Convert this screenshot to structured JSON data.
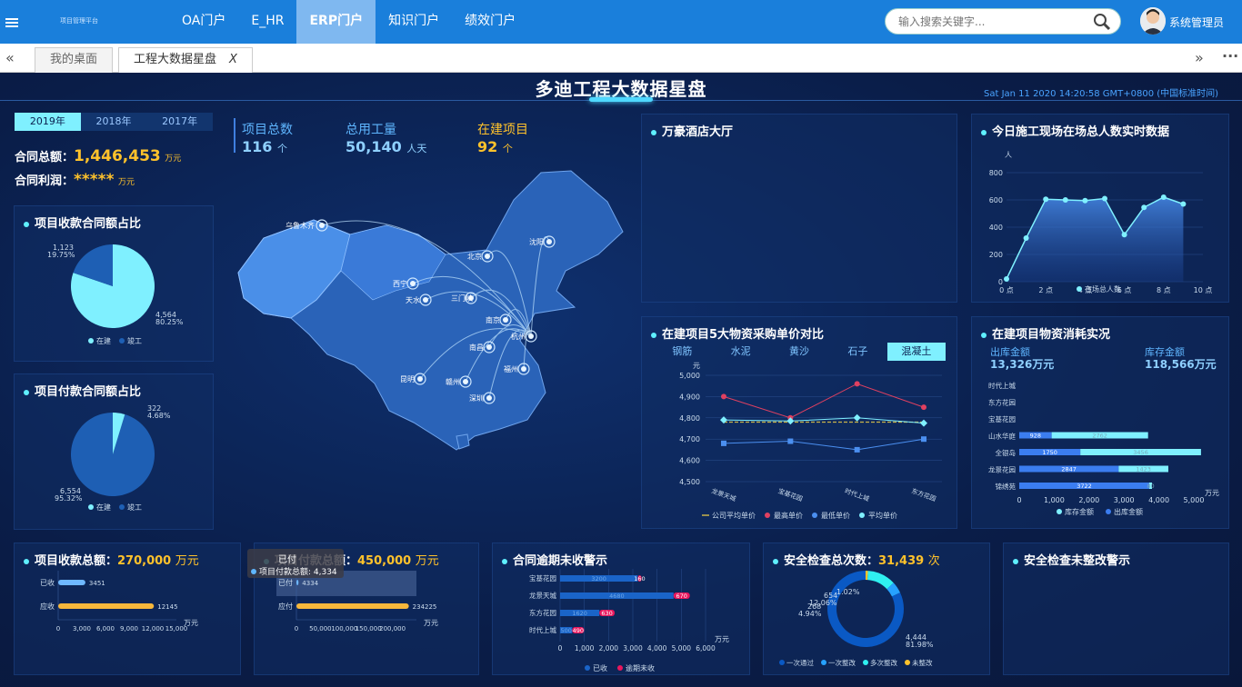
{
  "nav": {
    "brand": "项目管理平台",
    "items": [
      {
        "label": "OA门户",
        "active": false
      },
      {
        "label": "E_HR",
        "active": false
      },
      {
        "label": "ERP门户",
        "active": true
      },
      {
        "label": "知识门户",
        "active": false
      },
      {
        "label": "绩效门户",
        "active": false
      }
    ],
    "search_placeholder": "输入搜索关键字...",
    "user": "系统管理员"
  },
  "tabs": {
    "home": "我的桌面",
    "current": "工程大数据星盘",
    "close": "X"
  },
  "dashboard": {
    "title": "多迪工程大数据星盘",
    "datetime": "Sat Jan 11 2020 14:20:58 GMT+0800 (中国标准时间)",
    "years": [
      "2019年",
      "2018年",
      "2017年"
    ],
    "contract_total_label": "合同总额：",
    "contract_total": "1,446,453",
    "contract_profit_label": "合同利润：",
    "contract_profit": "*****",
    "unit_wan": "万元",
    "stats": [
      {
        "label": "项目总数",
        "value": "116",
        "unit": "个",
        "color": "#5fb6ff"
      },
      {
        "label": "总用工量",
        "value": "50,140",
        "unit": "人天",
        "color": "#5fb6ff"
      },
      {
        "label": "在建项目",
        "value": "92",
        "unit": "个",
        "color": "#ffc22b"
      }
    ],
    "map_cities": [
      "乌鲁木齐",
      "北京",
      "沈阳",
      "西宁",
      "天水",
      "三门峡",
      "南京",
      "杭州",
      "南昌",
      "昆明",
      "赣州",
      "福州",
      "深圳"
    ]
  },
  "panels": {
    "receipt_ratio": {
      "title": "项目收款合同额占比",
      "legend": [
        "在建",
        "竣工"
      ],
      "in_progress": {
        "value": "4,564",
        "pct": "80.25%"
      },
      "done": {
        "value": "1,123",
        "pct": "19.75%"
      }
    },
    "payment_ratio": {
      "title": "项目付款合同额占比",
      "legend": [
        "在建",
        "竣工"
      ],
      "in_progress": {
        "value": "6,554",
        "pct": "95.32%"
      },
      "done": {
        "value": "322",
        "pct": "4.68%"
      }
    },
    "hotel": {
      "title": "万豪酒店大厅"
    },
    "realtime": {
      "title": "今日施工现场在场总人数实时数据",
      "ylabel": "人",
      "legend": "在场总人数"
    },
    "material_price": {
      "title": "在建项目5大物资采购单价对比",
      "tabs": [
        "钢筋",
        "水泥",
        "黄沙",
        "石子",
        "混凝土"
      ],
      "ylabel": "元",
      "legend": [
        "公司平均单价",
        "最高单价",
        "最低单价",
        "平均单价"
      ]
    },
    "material_use": {
      "title": "在建项目物资消耗实况",
      "out_label": "出库金额",
      "out_value": "13,326万元",
      "stock_label": "库存金额",
      "stock_value": "118,566万元",
      "legend": [
        "库存金额",
        "出库金额"
      ],
      "xunit": "万元"
    },
    "receipt_total": {
      "title": "项目收款总额：",
      "value": "270,000",
      "unit": "万元",
      "xunit": "万元"
    },
    "payment_total": {
      "title": "项目付款总额：",
      "value": "450,000",
      "unit": "万元",
      "tooltip_head": "已付",
      "tooltip_body": "项目付款总额: 4,334",
      "xunit": "万元"
    },
    "overdue": {
      "title": "合同逾期未收警示",
      "legend": [
        "已收",
        "逾期未收"
      ],
      "xunit": "万元"
    },
    "safety": {
      "title": "安全检查总次数：",
      "value": "31,439",
      "unit": "次",
      "legend": [
        "一次通过",
        "一次整改",
        "多次整改",
        "未整改"
      ]
    },
    "safety_warn": {
      "title": "安全检查未整改警示"
    }
  },
  "chart_data": [
    {
      "type": "pie",
      "title": "项目收款合同额占比",
      "series": [
        {
          "name": "在建",
          "value": 4564,
          "pct": "80.25%"
        },
        {
          "name": "竣工",
          "value": 1123,
          "pct": "19.75%"
        }
      ]
    },
    {
      "type": "pie",
      "title": "项目付款合同额占比",
      "series": [
        {
          "name": "在建",
          "value": 6554,
          "pct": "95.32%"
        },
        {
          "name": "竣工",
          "value": 322,
          "pct": "4.68%"
        }
      ]
    },
    {
      "type": "area",
      "title": "今日施工现场在场总人数实时数据",
      "ylabel": "人",
      "x": [
        0,
        1,
        2,
        3,
        4,
        5,
        6,
        7,
        8,
        9,
        10
      ],
      "x_ticks": [
        "0 点",
        "2 点",
        "4 点",
        "6 点",
        "8 点",
        "10 点"
      ],
      "x_tick_values": [
        0,
        2,
        4,
        6,
        8,
        10
      ],
      "series": [
        {
          "name": "在场总人数",
          "values": [
            20,
            320,
            605,
            600,
            595,
            610,
            345,
            545,
            620,
            570,
            null
          ]
        }
      ],
      "ylim": [
        0,
        800
      ],
      "y_ticks": [
        0,
        200,
        400,
        600,
        800
      ],
      "xlim": [
        0,
        10
      ]
    },
    {
      "type": "line",
      "title": "在建项目5大物资采购单价对比",
      "ylabel": "元",
      "categories": [
        "龙景天城",
        "宝基花园",
        "时代上城",
        "东方花园"
      ],
      "ylim": [
        4500,
        5000
      ],
      "y_ticks": [
        "4,500",
        "4,600",
        "4,700",
        "4,800",
        "4,900",
        "5,000"
      ],
      "series": [
        {
          "name": "公司平均单价",
          "values": [
            4780,
            4780,
            4780,
            4780
          ],
          "color": "#c9b34a"
        },
        {
          "name": "最高单价",
          "values": [
            4900,
            4800,
            4960,
            4850
          ],
          "color": "#e04060"
        },
        {
          "name": "最低单价",
          "values": [
            4680,
            4690,
            4650,
            4700
          ],
          "color": "#4b8ff0"
        },
        {
          "name": "平均单价",
          "values": [
            4790,
            4785,
            4800,
            4775
          ],
          "color": "#7ff0ff"
        }
      ]
    },
    {
      "type": "bar",
      "title": "在建项目物资消耗实况",
      "orientation": "horizontal",
      "stacked": true,
      "categories": [
        "时代上城",
        "东方花园",
        "宝基花园",
        "山水华庭",
        "全银岛",
        "龙景花园",
        "锦绣苑"
      ],
      "xlim": [
        0,
        5000
      ],
      "x_ticks": [
        "0",
        "1,000",
        "2,000",
        "3,000",
        "4,000",
        "5,000"
      ],
      "series": [
        {
          "name": "出库金额",
          "values": [
            0,
            0,
            0,
            928,
            1750,
            2847,
            3722
          ],
          "color": "#3b7df0"
        },
        {
          "name": "库存金额",
          "values": [
            0,
            0,
            0,
            2762,
            3456,
            1423,
            80
          ],
          "color": "#7ff0ff"
        }
      ]
    },
    {
      "type": "bar",
      "title": "项目收款总额",
      "orientation": "horizontal",
      "categories": [
        "已收",
        "应收"
      ],
      "values": [
        3451,
        12145
      ],
      "xlim": [
        0,
        15000
      ],
      "x_ticks": [
        "0",
        "3,000",
        "6,000",
        "9,000",
        "12,000",
        "15,000"
      ]
    },
    {
      "type": "bar",
      "title": "项目付款总额",
      "orientation": "horizontal",
      "categories": [
        "已付",
        "应付"
      ],
      "values": [
        4334,
        234225
      ],
      "xlim": [
        0,
        250000
      ],
      "x_ticks": [
        "0",
        "50,000",
        "100,000",
        "150,000",
        "200,000"
      ]
    },
    {
      "type": "bar",
      "title": "合同逾期未收警示",
      "orientation": "horizontal",
      "stacked": true,
      "categories": [
        "宝基花园",
        "龙景天城",
        "东方花园",
        "时代上城"
      ],
      "xlim": [
        0,
        6000
      ],
      "x_ticks": [
        "0",
        "1,000",
        "2,000",
        "3,000",
        "4,000",
        "5,000",
        "6,000"
      ],
      "series": [
        {
          "name": "已收",
          "values": [
            3200,
            4680,
            1620,
            500
          ],
          "color": "#1a64c8"
        },
        {
          "name": "逾期未收",
          "values": [
            160,
            670,
            630,
            490
          ],
          "color": "#e8175d"
        }
      ]
    },
    {
      "type": "pie",
      "title": "安全检查总次数",
      "donut": true,
      "series": [
        {
          "name": "一次通过",
          "value": 4444,
          "pct": "81.98%"
        },
        {
          "name": "一次整改",
          "value": 268,
          "pct": "4.94%"
        },
        {
          "name": "多次整改",
          "value": 654,
          "pct": "12.06%"
        },
        {
          "name": "未整改",
          "value": 55,
          "pct": "1.02%"
        }
      ]
    }
  ]
}
